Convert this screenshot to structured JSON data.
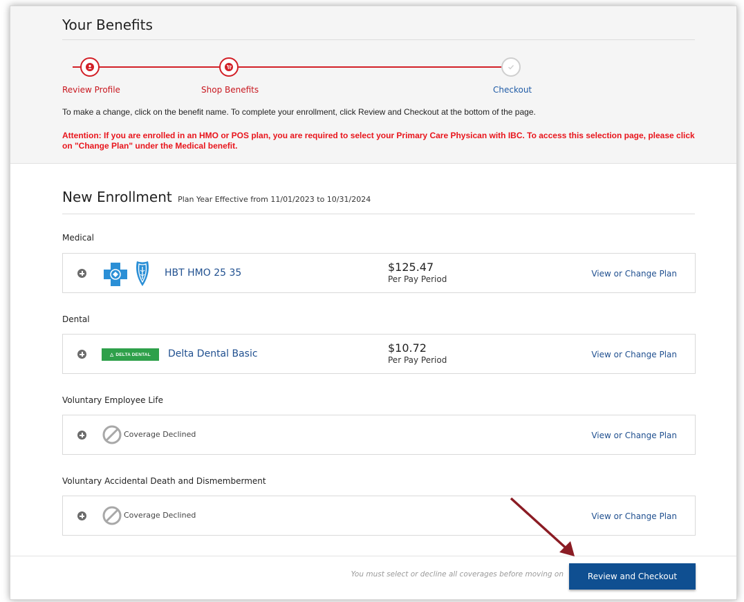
{
  "header": {
    "title": "Your Benefits"
  },
  "stepper": {
    "steps": [
      {
        "label": "Review Profile",
        "state": "active"
      },
      {
        "label": "Shop Benefits",
        "state": "active"
      },
      {
        "label": "Checkout",
        "state": "pending"
      }
    ]
  },
  "instructions": "To make a change, click on the benefit name. To complete your enrollment, click Review and Checkout at the bottom of the page.",
  "attention": "Attention: If you are enrolled in an HMO or POS plan, you are required to select your Primary Care Physican with IBC.  To access this selection page, please click on \"Change Plan\" under the Medical benefit.",
  "enrollment": {
    "title": "New Enrollment",
    "subtitle": "Plan Year Effective from 11/01/2023 to 10/31/2024"
  },
  "benefits": [
    {
      "section": "Medical",
      "plan": "HBT HMO 25 35",
      "price": "$125.47",
      "price_period": "Per Pay Period",
      "link": "View or Change Plan",
      "logo": "bcbs-logo"
    },
    {
      "section": "Dental",
      "plan": "Delta Dental Basic",
      "price": "$10.72",
      "price_period": "Per Pay Period",
      "link": "View or Change Plan",
      "logo": "delta-dental-logo",
      "logo_text": "DELTA DENTAL"
    },
    {
      "section": "Voluntary Employee Life",
      "status": "Coverage Declined",
      "link": "View or Change Plan"
    },
    {
      "section": "Voluntary Accidental Death and Dismemberment",
      "status": "Coverage Declined",
      "link": "View or Change Plan"
    }
  ],
  "footer": {
    "note": "You must select or decline all coverages before moving on",
    "button": "Review and Checkout"
  },
  "colors": {
    "accent_red": "#d21f26",
    "link_blue": "#1f4f8f",
    "button_blue": "#0f4f91",
    "annotation_arrow": "#8b1c24"
  },
  "icons": [
    "user-icon",
    "cart-icon",
    "check-icon",
    "expand-plus-icon",
    "declined-icon",
    "annotation-arrow"
  ]
}
